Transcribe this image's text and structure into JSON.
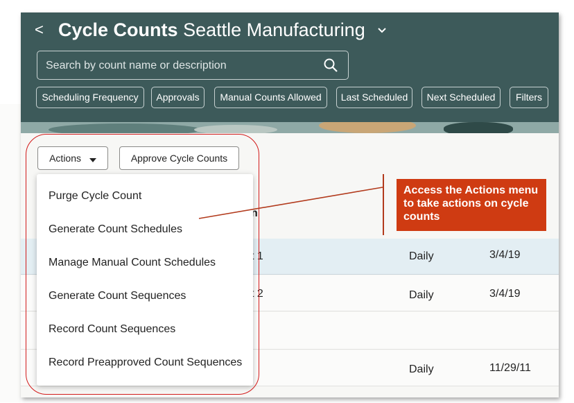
{
  "header": {
    "back_label": "<",
    "title_bold": "Cycle Counts",
    "title_org": "Seattle Manufacturing",
    "search_placeholder": "Search by count name or description",
    "filters": [
      "Scheduling Frequency",
      "Approvals",
      "Manual Counts Allowed",
      "Last Scheduled",
      "Next Scheduled",
      "Filters"
    ]
  },
  "toolbar": {
    "actions_label": "Actions",
    "approve_label": "Approve Cycle Counts"
  },
  "actions_menu": {
    "items": [
      "Purge Cycle Count",
      "Generate Count Schedules",
      "Manage Manual Count Schedules",
      "Generate Count Sequences",
      "Record Count Sequences",
      "Record Preapproved Count Sequences"
    ]
  },
  "table": {
    "header_fragment": "n",
    "rows": [
      {
        "name_fragment": "t 1",
        "frequency": "Daily",
        "date": "3/4/19"
      },
      {
        "name_fragment": "t 2",
        "frequency": "Daily",
        "date": "3/4/19"
      },
      {
        "name_fragment": "",
        "frequency": "",
        "date": ""
      },
      {
        "name_fragment": "",
        "frequency": "Daily",
        "date": "11/29/11"
      }
    ]
  },
  "callout": {
    "text": "Access the Actions menu to take actions on cycle counts",
    "color": "#cf3b12"
  },
  "colors": {
    "header_bg": "#3d5a5a",
    "selected_row": "#e3eef3",
    "annotation": "#d21a1a"
  },
  "icons": {
    "search": "search-icon",
    "actions_dropdown": "caret-down-icon",
    "title_dropdown": "chevron-down-icon",
    "back": "chevron-left-icon"
  }
}
